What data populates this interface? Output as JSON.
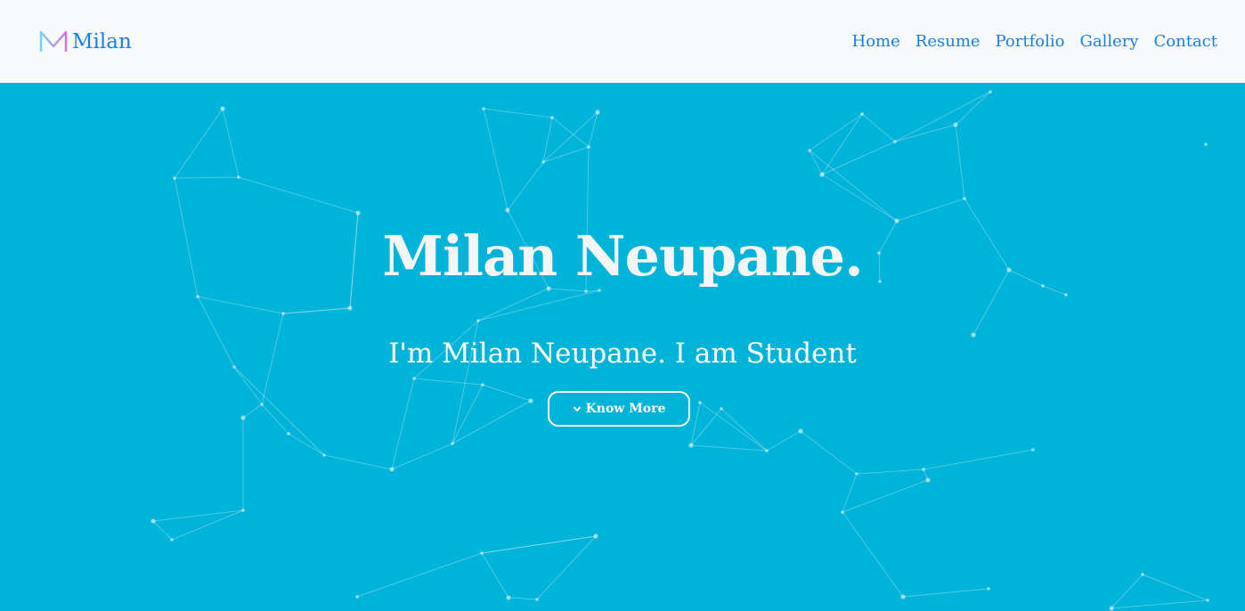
{
  "brand": {
    "name": "Milan",
    "logo_icon": "m-logo-icon",
    "logo_colors": [
      "#6fd3ff",
      "#d66ee8"
    ]
  },
  "nav": {
    "items": [
      {
        "label": "Home"
      },
      {
        "label": "Resume"
      },
      {
        "label": "Portfolio"
      },
      {
        "label": "Gallery"
      },
      {
        "label": "Contact"
      }
    ],
    "link_color": "#1a7fe0"
  },
  "hero": {
    "title": "Milan Neupane.",
    "subtitle": "I'm Milan Neupane. I am Student",
    "cta": {
      "label": "Know More",
      "icon": "chevron-down-icon"
    },
    "background_color": "#00b3d9",
    "background_pattern": "particle-network"
  }
}
